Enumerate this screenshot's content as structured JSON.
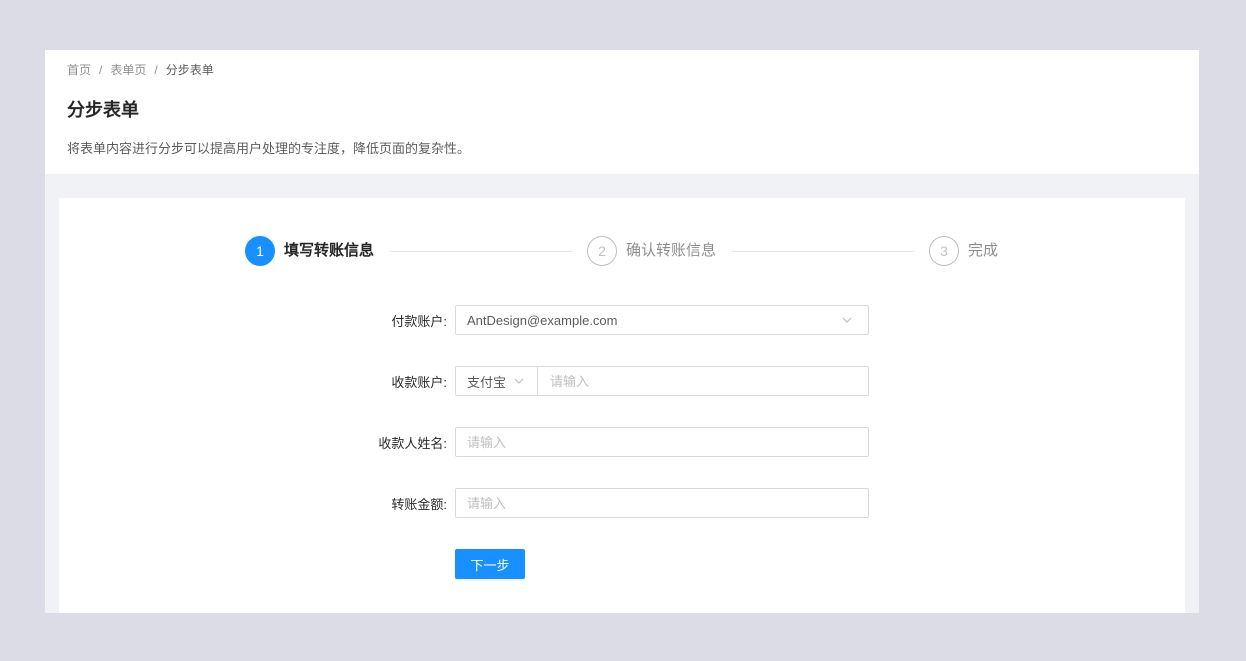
{
  "breadcrumb": {
    "items": [
      "首页",
      "表单页",
      "分步表单"
    ],
    "separator": "/"
  },
  "header": {
    "title": "分步表单",
    "description": "将表单内容进行分步可以提高用户处理的专注度，降低页面的复杂性。"
  },
  "steps": {
    "current": 1,
    "items": [
      {
        "number": "1",
        "title": "填写转账信息"
      },
      {
        "number": "2",
        "title": "确认转账信息"
      },
      {
        "number": "3",
        "title": "完成"
      }
    ]
  },
  "form": {
    "payer_account": {
      "label": "付款账户:",
      "value": "AntDesign@example.com"
    },
    "payee_account": {
      "label": "收款账户:",
      "channel": "支付宝",
      "placeholder": "请输入"
    },
    "payee_name": {
      "label": "收款人姓名:",
      "placeholder": "请输入"
    },
    "amount": {
      "label": "转账金额:",
      "placeholder": "请输入"
    },
    "next_button": "下一步"
  },
  "icons": {
    "dropdown_arrow": "chevron-down-icon"
  },
  "colors": {
    "primary": "#1890ff",
    "page_background": "#f0f2f5",
    "border": "#d9d9d9",
    "placeholder": "#bfbfbf"
  }
}
